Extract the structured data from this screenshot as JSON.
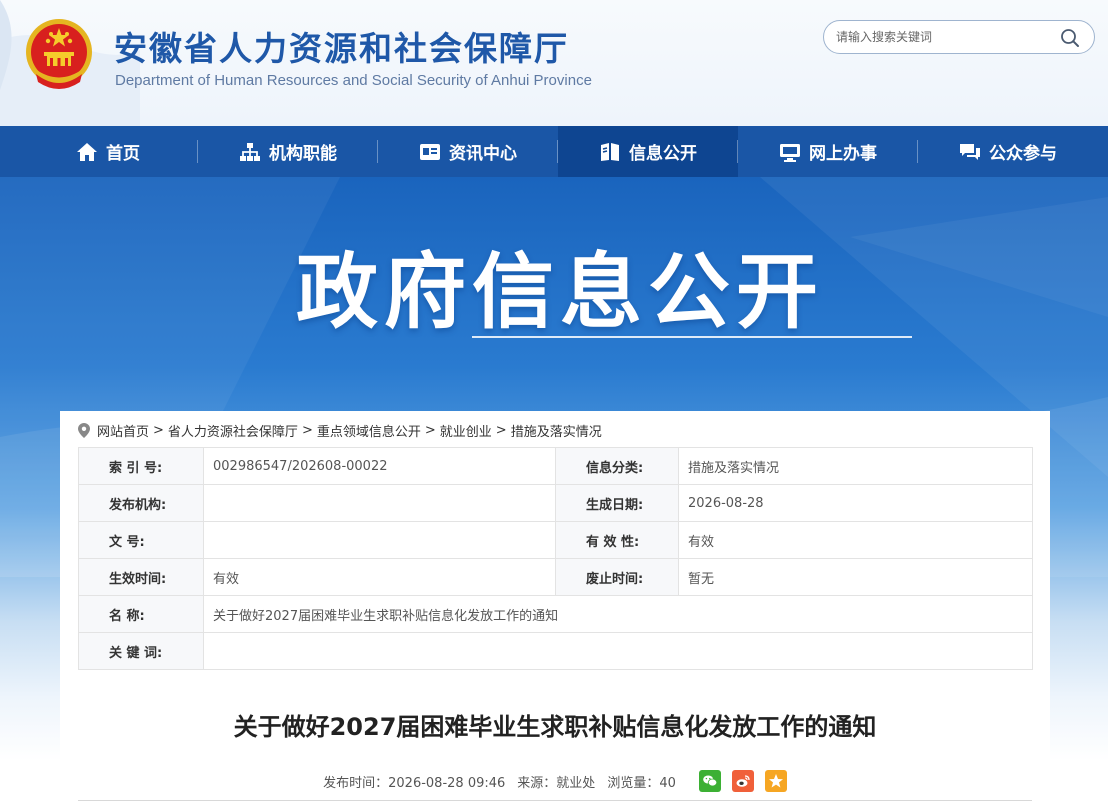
{
  "header": {
    "title_cn": "安徽省人力资源和社会保障厅",
    "title_en": "Department of Human Resources and Social Security of Anhui Province",
    "search_placeholder": "请输入搜索关键词"
  },
  "nav": {
    "items": [
      {
        "label": "首页",
        "icon": "home-icon"
      },
      {
        "label": "机构职能",
        "icon": "org-chart-icon"
      },
      {
        "label": "资讯中心",
        "icon": "news-icon"
      },
      {
        "label": "信息公开",
        "icon": "book-icon",
        "active": true
      },
      {
        "label": "网上办事",
        "icon": "monitor-icon"
      },
      {
        "label": "公众参与",
        "icon": "chat-icon"
      }
    ]
  },
  "banner": {
    "title": "政府信息公开"
  },
  "breadcrumb": [
    "网站首页",
    "省人力资源社会保障厅",
    "重点领域信息公开",
    "就业创业",
    "措施及落实情况"
  ],
  "meta": {
    "index_label": "索  引  号:",
    "index_value": "002986547/202608-00022",
    "category_label": "信息分类:",
    "category_value": "措施及落实情况",
    "publisher_label": "发布机构:",
    "publisher_value": "",
    "date_label": "生成日期:",
    "date_value": "2026-08-28",
    "docno_label": "文      号:",
    "docno_value": "",
    "validity_label": "有  效  性:",
    "validity_value": "有效",
    "effective_label": "生效时间:",
    "effective_value": "有效",
    "expire_label": "废止时间:",
    "expire_value": "暂无",
    "name_label": "名      称:",
    "name_value": "关于做好2027届困难毕业生求职补贴信息化发放工作的通知",
    "keywords_label": "关  键  词:",
    "keywords_value": ""
  },
  "document": {
    "title": "关于做好2027届困难毕业生求职补贴信息化发放工作的通知",
    "publish_time": "发布时间：2026-08-28 09:46",
    "source": "来源：就业处",
    "views": "浏览量：40"
  },
  "colors": {
    "nav_bg": "#1a56a6",
    "nav_active": "#0e4591",
    "title_blue": "#1f58a8",
    "wechat_green": "#3cb034",
    "weibo_orange": "#f0603a",
    "qzone_orange": "#f6a623"
  }
}
